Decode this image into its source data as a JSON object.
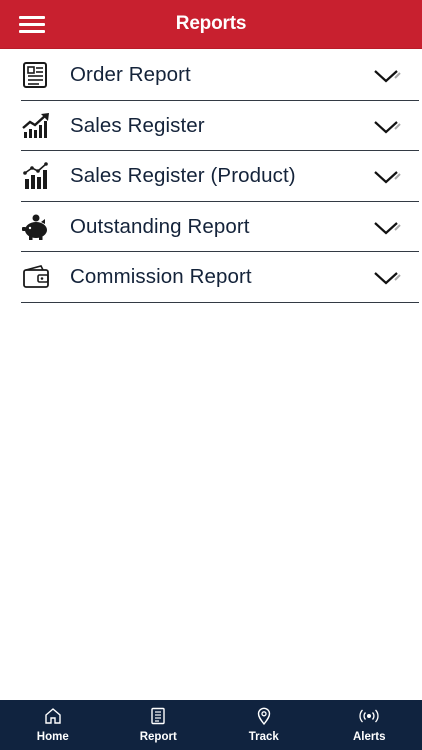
{
  "header": {
    "title": "Reports",
    "menu_icon": "hamburger-menu-icon",
    "background_color": "#c8202f"
  },
  "reports": [
    {
      "label": "Order Report",
      "icon": "newspaper-icon"
    },
    {
      "label": "Sales Register",
      "icon": "trending-up-chart-icon"
    },
    {
      "label": "Sales Register (Product)",
      "icon": "bar-chart-icon"
    },
    {
      "label": "Outstanding Report",
      "icon": "piggy-bank-icon"
    },
    {
      "label": "Commission Report",
      "icon": "wallet-icon"
    }
  ],
  "bottom_nav": [
    {
      "label": "Home",
      "icon": "home-icon"
    },
    {
      "label": "Report",
      "icon": "report-icon"
    },
    {
      "label": "Track",
      "icon": "location-pin-icon"
    },
    {
      "label": "Alerts",
      "icon": "broadcast-icon"
    }
  ],
  "colors": {
    "nav_background": "#10233f",
    "text": "#14233a"
  }
}
